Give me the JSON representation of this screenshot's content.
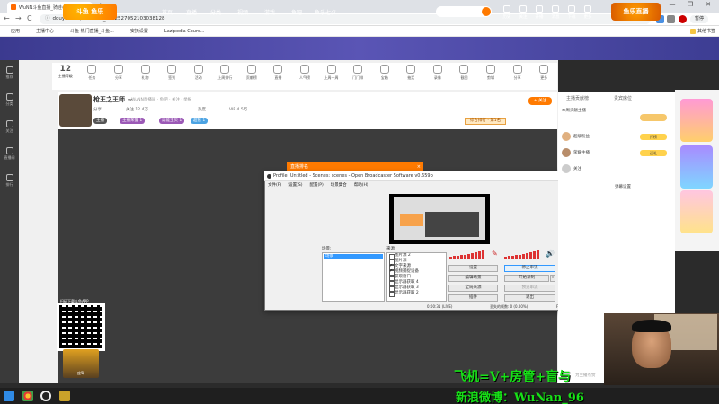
{
  "browser": {
    "tab_title": "WuNN斗鱼直播_骑娃小战直播_斗鱼直播",
    "tab_close": "×",
    "new_tab": "+",
    "window_controls": [
      "—",
      "❐",
      "✕"
    ],
    "back": "←",
    "forward": "→",
    "reload": "C",
    "url": "douyu.com/169690?_=0.2527052103038128",
    "pause_label": "暂停",
    "bookmarks": [
      {
        "label": "应用",
        "color": "#4285f4"
      },
      {
        "label": "主播中心",
        "color": "#ff7a00"
      },
      {
        "label": "斗鱼·热门直播_斗鱼...",
        "color": "#888888"
      },
      {
        "label": "安抚设置",
        "color": "#4a7dde"
      },
      {
        "label": "Lazipedia Cours...",
        "color": "#e53935"
      }
    ],
    "other_bookmarks": "其他书签"
  },
  "douyu_header": {
    "logo": "斗鱼 鱼乐",
    "nav": [
      "首页",
      "直播",
      "分类",
      "视频",
      "游戏",
      "鱼吧",
      "鱼乐七夕"
    ],
    "right_icons": [
      "历史",
      "关注",
      "开播",
      "消息",
      "下载",
      "更多"
    ],
    "promo_logo": "鱼乐直播"
  },
  "left_sidebar": [
    "推荐",
    "分类",
    "关注",
    "直播间",
    "排行"
  ],
  "gift_strip": {
    "level": "12",
    "level_label": "主播等级",
    "items": [
      "任务",
      "分享",
      "礼物",
      "签到",
      "活动",
      "上周排行",
      "贡献榜",
      "直播",
      "人气榜",
      "上周一周",
      "门门排",
      "宝箱",
      "抽奖",
      "录像",
      "截图",
      "剪辑",
      "分享",
      "更多"
    ]
  },
  "room": {
    "title": "枪王之王师 ~",
    "sub": "WuNN直播间 · 鱼吧 · 关注 · 举报",
    "follow": "+ 关注",
    "meta": [
      "分享",
      "关注 12.4万",
      "热度",
      "VIP 4.5万"
    ],
    "tags": [
      {
        "label": "主播",
        "color": "#555555"
      },
      {
        "label": "主播荣誉 1",
        "color": "#9b59b6"
      },
      {
        "label": "高能宝贝 1",
        "color": "#9b59b6"
      },
      {
        "label": "超管 1",
        "color": "#4ba3e3"
      }
    ],
    "rank": "综合排行 · 第1名"
  },
  "notice": {
    "label": "直播排名",
    "close": "×"
  },
  "qr_label": "扫码下载斗鱼APP",
  "car_label": "座驾",
  "obs": {
    "title": "Profile: Untitled - Scenes: scenes - Open Broadcaster Software v0.659b",
    "menus": [
      "文件(F)",
      "设置(S)",
      "配置(P)",
      "场景集合",
      "帮助(H)"
    ],
    "scenes_label": "场景:",
    "sources_label": "来源:",
    "scene_selected": "场景",
    "sources": [
      {
        "label": "图片源 2",
        "on": false
      },
      {
        "label": "图片源",
        "on": false
      },
      {
        "label": "文字来源",
        "on": true
      },
      {
        "label": "视频捕捉设备",
        "on": true
      },
      {
        "label": "获取窗口",
        "on": false
      },
      {
        "label": "显示器获取 4",
        "on": false
      },
      {
        "label": "显示器获取 3",
        "on": false
      },
      {
        "label": "显示器获取 2",
        "on": false
      }
    ],
    "buttons": [
      "设置",
      "停止串流",
      "编辑场景",
      "开始录制",
      "全局来源",
      "预览串流",
      "插件",
      "退出"
    ],
    "status": {
      "time": "0:00:31 (LIVE)",
      "dropped": "丢失的帧数: 0 (0.00%)",
      "fps": "FPS: 49",
      "bitrate": "kb/s"
    }
  },
  "right_panel": {
    "tabs": [
      "主播贡献榜",
      "贵宾席位"
    ],
    "items": [
      "本周贡献主播",
      "超级粉丝",
      "荣耀主播",
      "弹幕设置"
    ],
    "buttons": [
      "打榜",
      "送礼",
      "关注"
    ],
    "bottom": "为主播点赞"
  },
  "overlay": {
    "line1": "飞机=V+房管+盲与",
    "line2": "新浪微博：WuNan_96"
  },
  "taskbar": [
    "开始",
    "Chrome",
    "OBS",
    "游戏"
  ]
}
